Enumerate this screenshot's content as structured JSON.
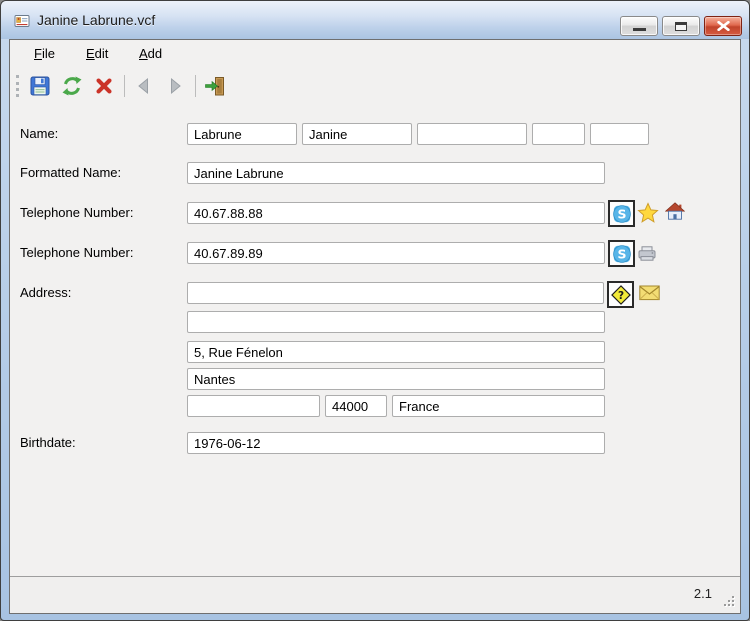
{
  "window": {
    "title": "Janine Labrune.vcf",
    "controls": [
      "minimize",
      "maximize",
      "close"
    ]
  },
  "menu": {
    "items": [
      {
        "label": "File"
      },
      {
        "label": "Edit"
      },
      {
        "label": "Add"
      }
    ]
  },
  "toolbar": {
    "buttons": [
      "save",
      "refresh",
      "delete",
      "back",
      "forward",
      "exit"
    ]
  },
  "fields": {
    "name": {
      "label": "Name:",
      "parts": [
        "Labrune",
        "Janine",
        "",
        "",
        ""
      ]
    },
    "formatted_name": {
      "label": "Formatted Name:",
      "value": "Janine Labrune"
    },
    "telephone1": {
      "label": "Telephone Number:",
      "value": "40.67.88.88",
      "icons": [
        "skype-call-button",
        "favorite-star",
        "home"
      ]
    },
    "telephone2": {
      "label": "Telephone Number:",
      "value": "40.67.89.89",
      "icons": [
        "skype-call-button",
        "fax"
      ]
    },
    "address": {
      "label": "Address:",
      "post_office_box": "",
      "extended": "",
      "street": "5, Rue Fénelon",
      "locality": "Nantes",
      "region": "",
      "postal_code": "44000",
      "country": "France",
      "icons": [
        "address-type-sign",
        "mail-envelope"
      ]
    },
    "birthdate": {
      "label": "Birthdate:",
      "value": "1976-06-12"
    }
  },
  "statusbar": {
    "version": "2.1"
  },
  "colors": {
    "frame_blue": "#b3cbe7",
    "titlebar_top": "#edf2fa",
    "titlebar_bottom": "#abc4e2",
    "client_bg": "#f2f1f0",
    "close_red": "#c1432b",
    "skype_blue": "#57b5e8",
    "star_yellow": "#ffd83e",
    "sign_yellow": "#f2ea3a",
    "envelope_yellow": "#f3dd74"
  }
}
